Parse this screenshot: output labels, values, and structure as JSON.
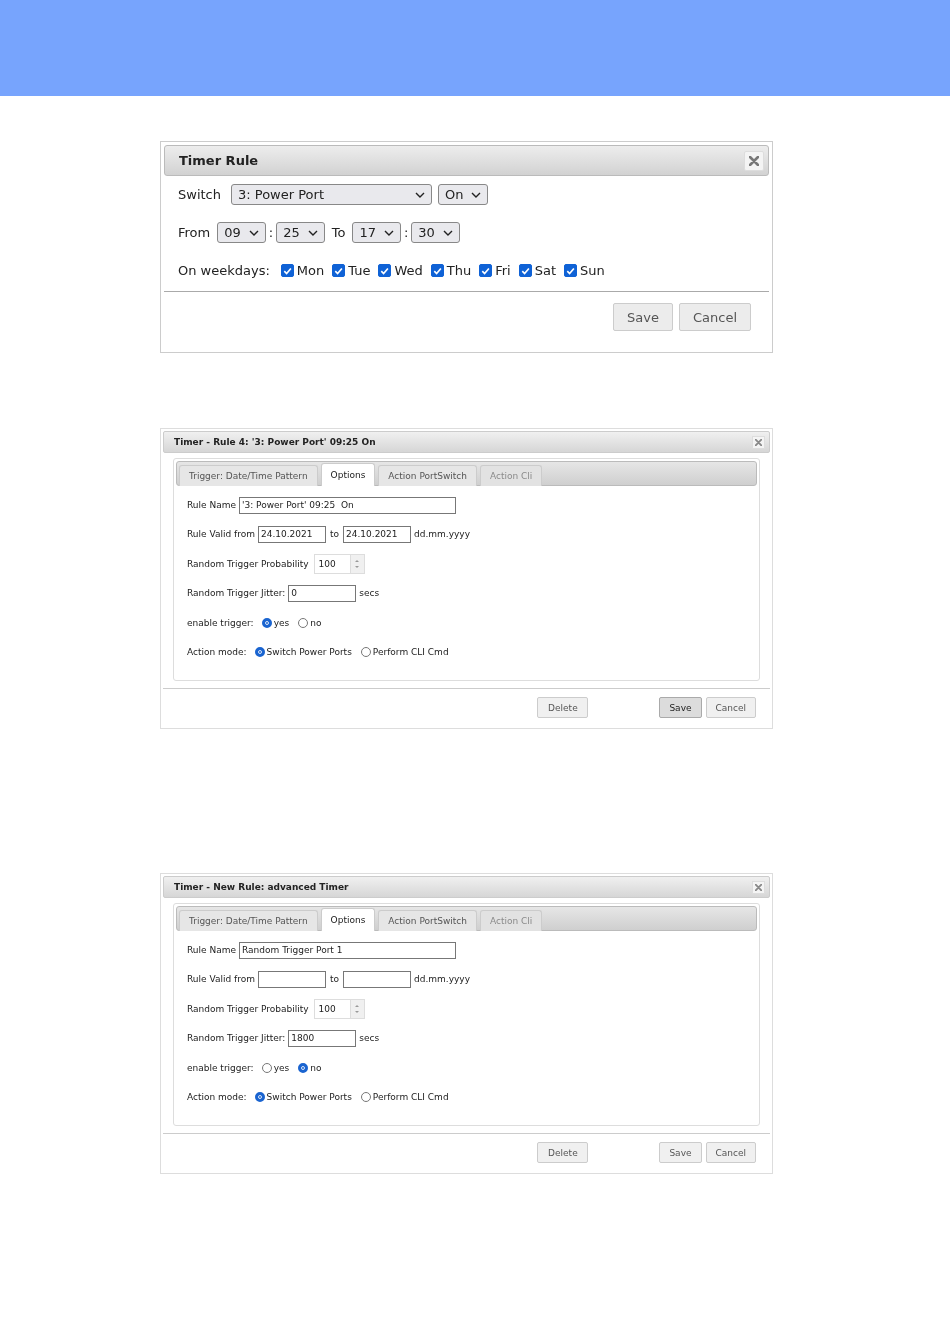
{
  "timer_rule": {
    "title": "Timer Rule",
    "switch_row": {
      "label": "Switch",
      "port": "3: Power Port",
      "state": "On"
    },
    "time_row": [
      {
        "kind": "label",
        "text": "From"
      },
      {
        "kind": "select",
        "value": "09"
      },
      {
        "kind": "sep",
        "text": ":"
      },
      {
        "kind": "select",
        "value": "25"
      },
      {
        "kind": "label",
        "text": "To"
      },
      {
        "kind": "select",
        "value": "17"
      },
      {
        "kind": "sep",
        "text": ":"
      },
      {
        "kind": "select",
        "value": "30"
      }
    ],
    "weekdays": {
      "label": "On weekdays:",
      "days": [
        {
          "label": "Mon",
          "checked": true
        },
        {
          "label": "Tue",
          "checked": true
        },
        {
          "label": "Wed",
          "checked": true
        },
        {
          "label": "Thu",
          "checked": true
        },
        {
          "label": "Fri",
          "checked": true
        },
        {
          "label": "Sat",
          "checked": true
        },
        {
          "label": "Sun",
          "checked": true
        }
      ]
    },
    "buttons": [
      "Save",
      "Cancel"
    ]
  },
  "advanced_dialogs": [
    {
      "title": "Timer - Rule 4: '3: Power Port' 09:25 On",
      "tabs": [
        {
          "label": "Trigger: Date/Time Pattern",
          "selected": false,
          "disabled": false
        },
        {
          "label": "Options",
          "selected": true,
          "disabled": false
        },
        {
          "label": "Action PortSwitch",
          "selected": false,
          "disabled": false
        },
        {
          "label": "Action Cli",
          "selected": false,
          "disabled": true
        }
      ],
      "rule_name_label": "Rule Name",
      "rule_name": "'3: Power Port' 09:25  On",
      "valid_label": "Rule Valid from",
      "valid_from": "24.10.2021",
      "to_label": "to",
      "valid_to": "24.10.2021",
      "date_hint": "dd.mm.yyyy",
      "probability_label": "Random Trigger Probability",
      "probability": "100",
      "jitter_label": "Random Trigger Jitter:",
      "jitter": "0",
      "jitter_unit": "secs",
      "enable": {
        "label": "enable trigger:",
        "options": [
          {
            "label": "yes",
            "selected": true
          },
          {
            "label": "no",
            "selected": false
          }
        ]
      },
      "action_mode": {
        "label": "Action mode:",
        "options": [
          {
            "label": "Switch Power Ports",
            "selected": true
          },
          {
            "label": "Perform CLI Cmd",
            "selected": false
          }
        ]
      },
      "buttons": [
        {
          "label": "Delete",
          "kind": "delete",
          "highlighted": false
        },
        {
          "label": "Save",
          "kind": "save",
          "highlighted": true
        },
        {
          "label": "Cancel",
          "kind": "cancel",
          "highlighted": false
        }
      ]
    },
    {
      "title": "Timer - New Rule: advanced Timer",
      "tabs": [
        {
          "label": "Trigger: Date/Time Pattern",
          "selected": false,
          "disabled": false
        },
        {
          "label": "Options",
          "selected": true,
          "disabled": false
        },
        {
          "label": "Action PortSwitch",
          "selected": false,
          "disabled": false
        },
        {
          "label": "Action Cli",
          "selected": false,
          "disabled": true
        }
      ],
      "rule_name_label": "Rule Name",
      "rule_name": "Random Trigger Port 1",
      "valid_label": "Rule Valid from",
      "to_label": "to",
      "date_hint": "dd.mm.yyyy",
      "probability_label": "Random Trigger Probability",
      "probability": "100",
      "jitter_label": "Random Trigger Jitter:",
      "jitter": "1800",
      "jitter_unit": "secs",
      "enable": {
        "label": "enable trigger:",
        "options": [
          {
            "label": "yes",
            "selected": false
          },
          {
            "label": "no",
            "selected": true
          }
        ]
      },
      "action_mode": {
        "label": "Action mode:",
        "options": [
          {
            "label": "Switch Power Ports",
            "selected": true
          },
          {
            "label": "Perform CLI Cmd",
            "selected": false
          }
        ]
      },
      "buttons": [
        {
          "label": "Delete",
          "kind": "delete",
          "highlighted": false
        },
        {
          "label": "Save",
          "kind": "save",
          "highlighted": false
        },
        {
          "label": "Cancel",
          "kind": "cancel",
          "highlighted": false
        }
      ]
    }
  ]
}
